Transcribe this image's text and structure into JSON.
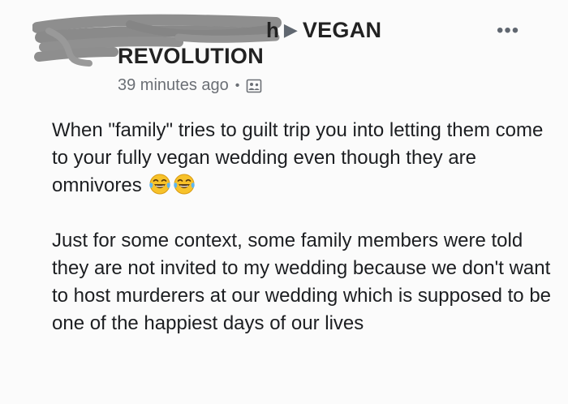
{
  "post": {
    "author_fragment": "h",
    "group_name_line1": "VEGAN",
    "group_name_line2": "REVOLUTION",
    "timestamp": "39 minutes ago",
    "separator": "•",
    "privacy_icon": "group-privacy-icon",
    "more_icon": "more-options-icon",
    "more_label": "•••",
    "paragraph1": "When \"family\" tries to guilt trip you into letting them come to your fully vegan wedding even though they are omnivores",
    "emojis": [
      "tears-of-joy-icon",
      "tears-of-joy-icon"
    ],
    "paragraph2": "Just for some context, some family members were told they are not invited to my wedding because we don't want to host murderers at our wedding which is supposed to be one of the happiest days of our lives"
  },
  "colors": {
    "background": "#fbfbfb",
    "text": "#1c1e21",
    "muted": "#6b6f75",
    "redaction": "#8e8e8e",
    "emoji_face": "#f7c22a"
  }
}
